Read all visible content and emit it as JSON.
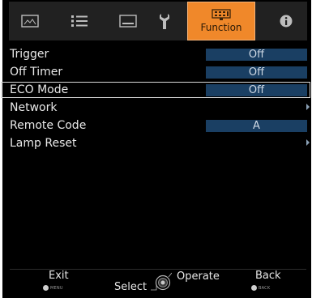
{
  "tabs": [
    {
      "name": "image",
      "label": ""
    },
    {
      "name": "setting",
      "label": ""
    },
    {
      "name": "display",
      "label": ""
    },
    {
      "name": "installation",
      "label": ""
    },
    {
      "name": "function",
      "label": "Function"
    },
    {
      "name": "information",
      "label": ""
    }
  ],
  "menu": {
    "items": [
      {
        "label": "Trigger",
        "value": "Off"
      },
      {
        "label": "Off Timer",
        "value": "Off"
      },
      {
        "label": "ECO Mode",
        "value": "Off"
      },
      {
        "label": "Network"
      },
      {
        "label": "Remote Code",
        "value": "A"
      },
      {
        "label": "Lamp Reset"
      }
    ]
  },
  "footer": {
    "exit_label": "Exit",
    "exit_button_caption": "MENU",
    "select_label": "Select",
    "operate_label": "Operate",
    "back_label": "Back",
    "back_button_caption": "BACK"
  },
  "colors": {
    "active_tab": "#f0882a",
    "value_box": "#1a3f63",
    "background": "#000000"
  }
}
